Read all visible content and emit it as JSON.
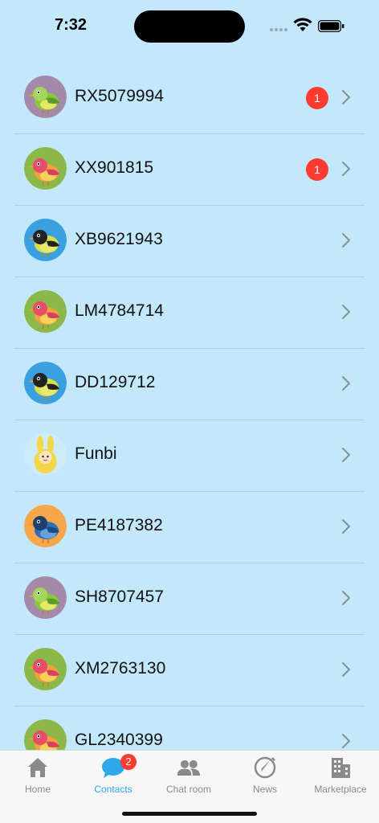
{
  "status_bar": {
    "time": "7:32"
  },
  "contacts": [
    {
      "name": "RX5079994",
      "unread": "1",
      "avatar_bg": "#a48aa8",
      "bird": "green"
    },
    {
      "name": "XX901815",
      "unread": "1",
      "avatar_bg": "#8cb84a",
      "bird": "red"
    },
    {
      "name": "XB9621943",
      "unread": "",
      "avatar_bg": "#3aa0e0",
      "bird": "black"
    },
    {
      "name": "LM4784714",
      "unread": "",
      "avatar_bg": "#8cb84a",
      "bird": "red"
    },
    {
      "name": "DD129712",
      "unread": "",
      "avatar_bg": "#3aa0e0",
      "bird": "black"
    },
    {
      "name": "Funbi",
      "unread": "",
      "avatar_bg": "#cfeaf8",
      "bird": "bunny"
    },
    {
      "name": "PE4187382",
      "unread": "",
      "avatar_bg": "#f7a64a",
      "bird": "blue"
    },
    {
      "name": "SH8707457",
      "unread": "",
      "avatar_bg": "#a48aa8",
      "bird": "green"
    },
    {
      "name": "XM2763130",
      "unread": "",
      "avatar_bg": "#8cb84a",
      "bird": "red"
    },
    {
      "name": "GL2340399",
      "unread": "",
      "avatar_bg": "#8cb84a",
      "bird": "red"
    }
  ],
  "tabs": [
    {
      "label": "Home",
      "icon": "home-icon",
      "active": false
    },
    {
      "label": "Contacts",
      "icon": "chat-bubble-icon",
      "active": true,
      "badge": "2"
    },
    {
      "label": "Chat room",
      "icon": "people-icon",
      "active": false
    },
    {
      "label": "News",
      "icon": "compass-icon",
      "active": false
    },
    {
      "label": "Marketplace",
      "icon": "building-icon",
      "active": false
    }
  ],
  "colors": {
    "background": "#c3e8fb",
    "accent": "#2da8e8",
    "badge": "#ff3b30"
  }
}
